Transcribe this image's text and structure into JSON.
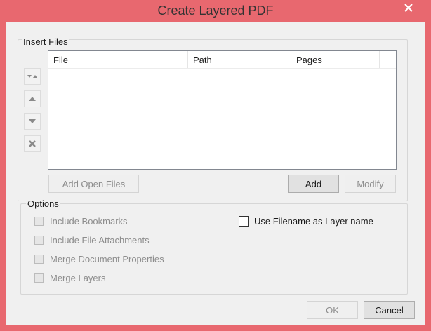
{
  "window": {
    "title": "Create Layered PDF",
    "close_icon": "close-icon",
    "frame_color": "#e8686f"
  },
  "insert_files": {
    "label": "Insert Files",
    "side_buttons": [
      {
        "name": "move-top-bottom-icon",
        "enabled": false
      },
      {
        "name": "move-up-icon",
        "enabled": false
      },
      {
        "name": "move-down-icon",
        "enabled": false
      },
      {
        "name": "remove-icon",
        "enabled": false
      }
    ],
    "table": {
      "columns": [
        "File",
        "Path",
        "Pages"
      ],
      "rows": []
    },
    "add_open_files_label": "Add Open Files",
    "add_label": "Add",
    "modify_label": "Modify"
  },
  "options": {
    "label": "Options",
    "include_bookmarks": {
      "label": "Include Bookmarks",
      "checked": false,
      "enabled": false
    },
    "include_file_attachments": {
      "label": "Include File Attachments",
      "checked": false,
      "enabled": false
    },
    "merge_document_properties": {
      "label": "Merge Document Properties",
      "checked": false,
      "enabled": false
    },
    "merge_layers": {
      "label": "Merge Layers",
      "checked": false,
      "enabled": false
    },
    "use_filename_as_layer_name": {
      "label": "Use Filename as Layer name",
      "checked": false,
      "enabled": true
    }
  },
  "footer": {
    "ok_label": "OK",
    "cancel_label": "Cancel"
  }
}
